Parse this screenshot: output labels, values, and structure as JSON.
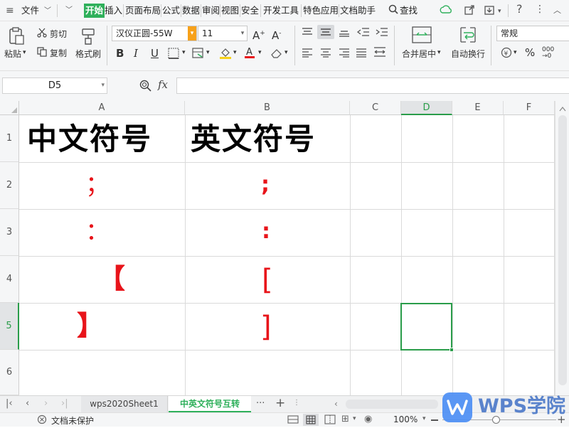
{
  "menubar": {
    "file": "文件",
    "tabs": [
      "开始",
      "插入",
      "页面布局",
      "公式",
      "数据",
      "审阅",
      "视图",
      "安全",
      "开发工具",
      "特色应用",
      "文档助手"
    ],
    "search": "查找"
  },
  "ribbon": {
    "paste": "粘贴",
    "cut": "剪切",
    "copy": "复制",
    "format_painter": "格式刷",
    "font_name": "汉仪正圆-55W",
    "font_size": "11",
    "merge_center": "合并居中",
    "wrap_text": "自动换行",
    "number_format": "常规",
    "bold": "B",
    "italic": "I",
    "underline": "U",
    "percent": "%"
  },
  "formula_bar": {
    "name_box": "D5",
    "fx": "fx",
    "content": ""
  },
  "grid": {
    "columns": [
      "A",
      "B",
      "C",
      "D",
      "E",
      "F"
    ],
    "rows": [
      "1",
      "2",
      "3",
      "4",
      "5",
      "6"
    ],
    "header_a": "中文符号",
    "header_b": "英文符号",
    "cn_semicolon": "；",
    "cn_colon": "：",
    "cn_left_bracket": "【",
    "cn_right_bracket": "】",
    "en_semicolon": ";",
    "en_colon": ":",
    "en_left_bracket": "[",
    "en_right_bracket": "]"
  },
  "sheets": {
    "tabs": [
      "wps2020Sheet1",
      "中英文符号互转"
    ],
    "active": "中英文符号互转",
    "more": "···",
    "add": "+"
  },
  "status": {
    "doc_state": "文档未保护",
    "zoom": "100%"
  },
  "watermark": "WPS学院",
  "colors": {
    "accent": "#2fb05b",
    "symbol_red": "#e8141a",
    "selection": "#2a9d4a"
  }
}
